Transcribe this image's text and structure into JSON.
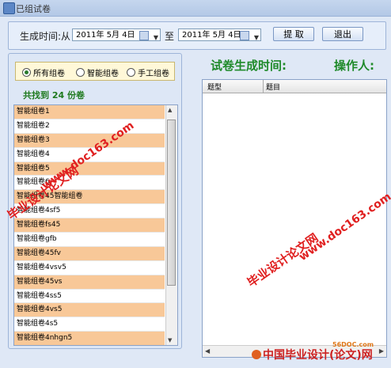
{
  "window": {
    "title": "已组试卷"
  },
  "toolbar": {
    "gen_time_label": "生成时间:从",
    "date_from": "2011年 5月 4日",
    "to_label": "至",
    "date_to": "2011年 5月 4日",
    "extract_button": "提  取",
    "exit_button": "退出"
  },
  "filter": {
    "options": [
      "所有组卷",
      "智能组卷",
      "手工组卷"
    ],
    "selected": "所有组卷",
    "found_text": "共找到  24  份卷"
  },
  "paper_list": [
    "智能组卷1",
    "智能组卷2",
    "智能组卷3",
    "智能组卷4",
    "智能组卷5",
    "智能组卷6",
    "智能组卷45智能组卷",
    "智能组卷4sf5",
    "智能组卷fs45",
    "智能组卷gfb",
    "智能组卷45fv",
    "智能组卷4vsv5",
    "智能组卷45vs",
    "智能组卷4ss5",
    "智能组卷4vs5",
    "智能组卷4s5",
    "智能组卷4nhgn5"
  ],
  "detail": {
    "gen_time_heading": "试卷生成时间:",
    "operator_heading": "操作人:",
    "columns": [
      "题型",
      "题目"
    ]
  },
  "watermarks": {
    "site": "www.doc163.com",
    "cn": "毕业设计论文网",
    "footer": "中国毕业设计(论文)网",
    "footer_site": "56DOC.com"
  },
  "colors": {
    "row_highlight": "#f8c898",
    "heading_green": "#1f8a2a",
    "watermark_red": "#e02020"
  }
}
